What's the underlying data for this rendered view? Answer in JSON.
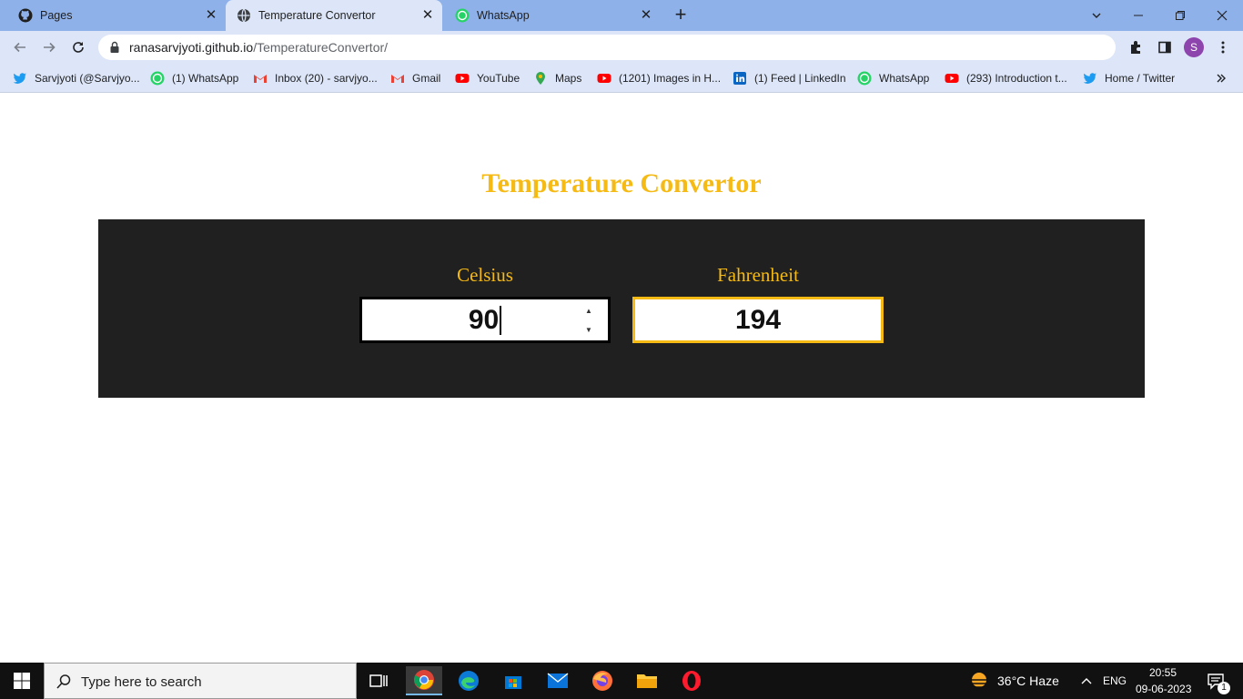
{
  "browser": {
    "tabs": [
      {
        "title": "Pages",
        "icon": "github-icon"
      },
      {
        "title": "Temperature Convertor",
        "icon": "globe-icon"
      },
      {
        "title": "WhatsApp",
        "icon": "whatsapp-icon"
      }
    ],
    "address": {
      "host": "ranasarvjyoti.github.io",
      "path": "/TemperatureConvertor/"
    },
    "profile_initial": "S",
    "bookmarks": [
      {
        "label": "Sarvjyoti (@Sarvjyo...",
        "icon": "twitter-icon"
      },
      {
        "label": "(1) WhatsApp",
        "icon": "whatsapp-icon"
      },
      {
        "label": "Inbox (20) - sarvjyo...",
        "icon": "gmail-icon"
      },
      {
        "label": "Gmail",
        "icon": "gmail-icon"
      },
      {
        "label": "YouTube",
        "icon": "youtube-icon"
      },
      {
        "label": "Maps",
        "icon": "maps-icon"
      },
      {
        "label": "(1201) Images in H...",
        "icon": "youtube-icon"
      },
      {
        "label": "(1) Feed | LinkedIn",
        "icon": "linkedin-icon"
      },
      {
        "label": "WhatsApp",
        "icon": "whatsapp-icon"
      },
      {
        "label": "(293) Introduction t...",
        "icon": "youtube-icon"
      },
      {
        "label": "Home / Twitter",
        "icon": "twitter-icon"
      }
    ]
  },
  "page": {
    "title": "Temperature Convertor",
    "celsius_label": "Celsius",
    "celsius_value": "90",
    "fahrenheit_label": "Fahrenheit",
    "fahrenheit_value": "194"
  },
  "taskbar": {
    "search_placeholder": "Type here to search",
    "weather": "36°C  Haze",
    "language": "ENG",
    "time": "20:55",
    "date": "09-06-2023",
    "notification_count": "1"
  },
  "colors": {
    "accent": "#f6ba14",
    "panel": "#202020",
    "chrome": "#dce6f8"
  }
}
